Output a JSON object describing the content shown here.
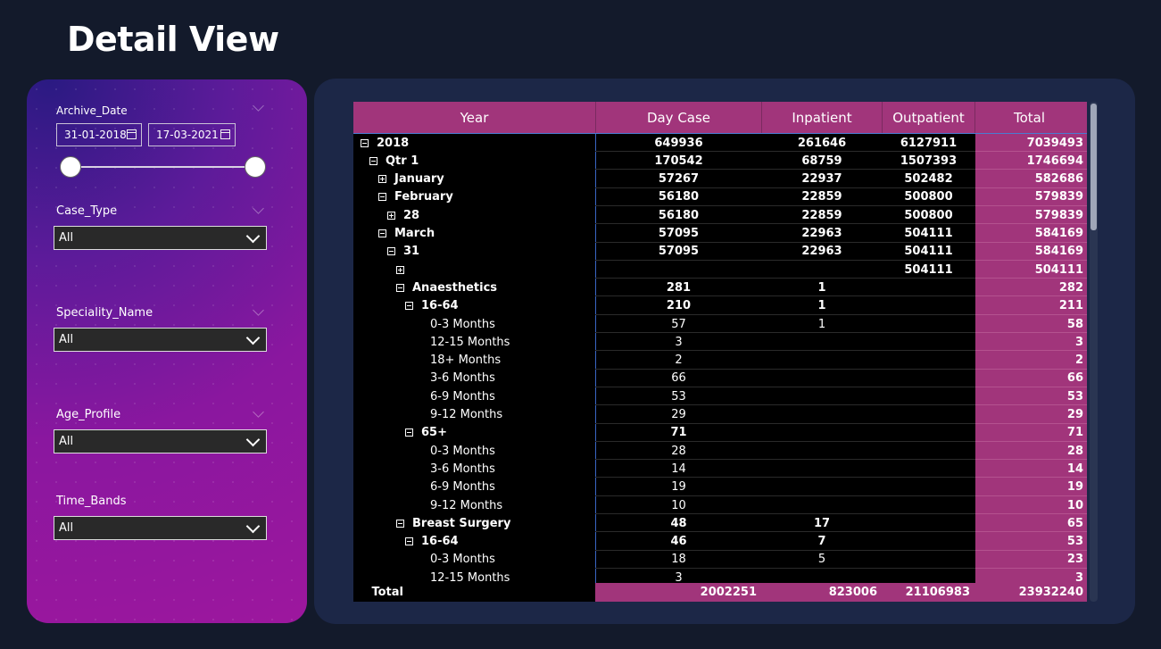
{
  "page": {
    "title": "Detail View"
  },
  "filters": {
    "archive_date": {
      "label": "Archive_Date",
      "start": "31-01-2018",
      "end": "17-03-2021"
    },
    "case_type": {
      "label": "Case_Type",
      "value": "All"
    },
    "speciality_name": {
      "label": "Speciality_Name",
      "value": "All"
    },
    "age_profile": {
      "label": "Age_Profile",
      "value": "All"
    },
    "time_bands": {
      "label": "Time_Bands",
      "value": "All"
    }
  },
  "matrix": {
    "columns": [
      "Year",
      "Day Case",
      "Inpatient",
      "Outpatient",
      "Total"
    ],
    "rows": [
      {
        "label": "2018",
        "level": 0,
        "expander": "minus",
        "bold": true,
        "day_case": "649936",
        "inpatient": "261646",
        "outpatient": "6127911",
        "total": "7039493"
      },
      {
        "label": "Qtr 1",
        "level": 1,
        "expander": "minus",
        "bold": true,
        "day_case": "170542",
        "inpatient": "68759",
        "outpatient": "1507393",
        "total": "1746694"
      },
      {
        "label": "January",
        "level": 2,
        "expander": "plus",
        "bold": true,
        "day_case": "57267",
        "inpatient": "22937",
        "outpatient": "502482",
        "total": "582686"
      },
      {
        "label": "February",
        "level": 2,
        "expander": "minus",
        "bold": true,
        "day_case": "56180",
        "inpatient": "22859",
        "outpatient": "500800",
        "total": "579839"
      },
      {
        "label": "28",
        "level": 3,
        "expander": "plus",
        "bold": true,
        "day_case": "56180",
        "inpatient": "22859",
        "outpatient": "500800",
        "total": "579839"
      },
      {
        "label": "March",
        "level": 2,
        "expander": "minus",
        "bold": true,
        "day_case": "57095",
        "inpatient": "22963",
        "outpatient": "504111",
        "total": "584169"
      },
      {
        "label": "31",
        "level": 3,
        "expander": "minus",
        "bold": true,
        "day_case": "57095",
        "inpatient": "22963",
        "outpatient": "504111",
        "total": "584169"
      },
      {
        "label": "",
        "level": 4,
        "expander": "plus",
        "bold": true,
        "day_case": "",
        "inpatient": "",
        "outpatient": "504111",
        "total": "504111"
      },
      {
        "label": "Anaesthetics",
        "level": 4,
        "expander": "minus",
        "bold": true,
        "day_case": "281",
        "inpatient": "1",
        "outpatient": "",
        "total": "282"
      },
      {
        "label": "16-64",
        "level": 5,
        "expander": "minus",
        "bold": true,
        "day_case": "210",
        "inpatient": "1",
        "outpatient": "",
        "total": "211"
      },
      {
        "label": "0-3 Months",
        "level": 6,
        "expander": "",
        "bold": false,
        "day_case": "57",
        "inpatient": "1",
        "outpatient": "",
        "total": "58"
      },
      {
        "label": "12-15 Months",
        "level": 6,
        "expander": "",
        "bold": false,
        "day_case": "3",
        "inpatient": "",
        "outpatient": "",
        "total": "3"
      },
      {
        "label": "18+ Months",
        "level": 6,
        "expander": "",
        "bold": false,
        "day_case": "2",
        "inpatient": "",
        "outpatient": "",
        "total": "2"
      },
      {
        "label": "3-6 Months",
        "level": 6,
        "expander": "",
        "bold": false,
        "day_case": "66",
        "inpatient": "",
        "outpatient": "",
        "total": "66"
      },
      {
        "label": "6-9 Months",
        "level": 6,
        "expander": "",
        "bold": false,
        "day_case": "53",
        "inpatient": "",
        "outpatient": "",
        "total": "53"
      },
      {
        "label": "9-12 Months",
        "level": 6,
        "expander": "",
        "bold": false,
        "day_case": "29",
        "inpatient": "",
        "outpatient": "",
        "total": "29"
      },
      {
        "label": "65+",
        "level": 5,
        "expander": "minus",
        "bold": true,
        "day_case": "71",
        "inpatient": "",
        "outpatient": "",
        "total": "71"
      },
      {
        "label": "0-3 Months",
        "level": 6,
        "expander": "",
        "bold": false,
        "day_case": "28",
        "inpatient": "",
        "outpatient": "",
        "total": "28"
      },
      {
        "label": "3-6 Months",
        "level": 6,
        "expander": "",
        "bold": false,
        "day_case": "14",
        "inpatient": "",
        "outpatient": "",
        "total": "14"
      },
      {
        "label": "6-9 Months",
        "level": 6,
        "expander": "",
        "bold": false,
        "day_case": "19",
        "inpatient": "",
        "outpatient": "",
        "total": "19"
      },
      {
        "label": "9-12 Months",
        "level": 6,
        "expander": "",
        "bold": false,
        "day_case": "10",
        "inpatient": "",
        "outpatient": "",
        "total": "10"
      },
      {
        "label": "Breast Surgery",
        "level": 4,
        "expander": "minus",
        "bold": true,
        "day_case": "48",
        "inpatient": "17",
        "outpatient": "",
        "total": "65"
      },
      {
        "label": "16-64",
        "level": 5,
        "expander": "minus",
        "bold": true,
        "day_case": "46",
        "inpatient": "7",
        "outpatient": "",
        "total": "53"
      },
      {
        "label": "0-3 Months",
        "level": 6,
        "expander": "",
        "bold": false,
        "day_case": "18",
        "inpatient": "5",
        "outpatient": "",
        "total": "23"
      },
      {
        "label": "12-15 Months",
        "level": 6,
        "expander": "",
        "bold": false,
        "day_case": "3",
        "inpatient": "",
        "outpatient": "",
        "total": "3"
      }
    ],
    "totals": {
      "label": "Total",
      "day_case": "2002251",
      "inpatient": "823006",
      "outpatient": "21106983",
      "total": "23932240"
    }
  },
  "colors": {
    "background": "#131a2b",
    "panel": "#1c2747",
    "accent": "#a1357b",
    "filter_gradient_end": "#9d179e"
  }
}
